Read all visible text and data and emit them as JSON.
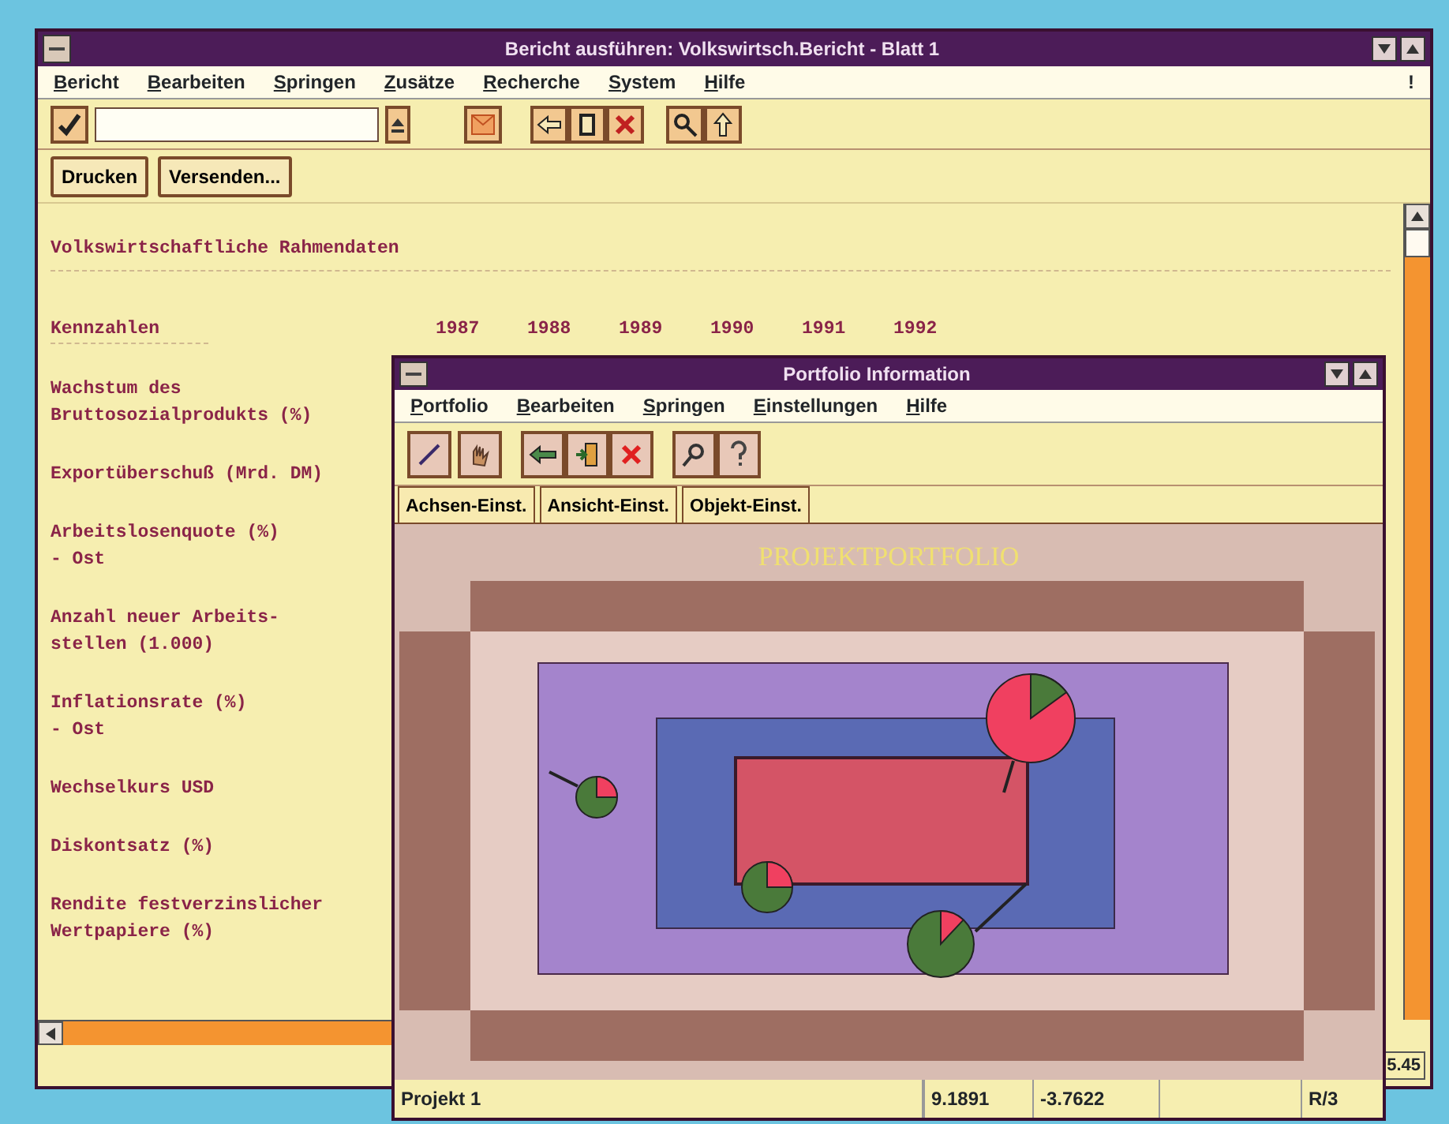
{
  "main_window": {
    "title": "Bericht ausführen: Volkswirtsch.Bericht - Blatt 1",
    "menu": [
      "Bericht",
      "Bearbeiten",
      "Springen",
      "Zusätze",
      "Recherche",
      "System",
      "Hilfe"
    ],
    "menu_extra": "!",
    "buttons": [
      "Drucken",
      "Versenden..."
    ],
    "report": {
      "heading": "Volkswirtschaftliche Rahmendaten",
      "columns_label": "Kennzahlen",
      "years": [
        "1987",
        "1988",
        "1989",
        "1990",
        "1991",
        "1992"
      ],
      "rows": [
        {
          "lines": [
            "Wachstum des",
            "Bruttosozialprodukts (%)"
          ]
        },
        {
          "lines": [
            "Exportüberschuß (Mrd. DM)"
          ]
        },
        {
          "lines": [
            "Arbeitslosenquote (%)",
            "- Ost"
          ]
        },
        {
          "lines": [
            "Anzahl neuer Arbeits-",
            "stellen (1.000)"
          ]
        },
        {
          "lines": [
            "Inflationsrate (%)",
            "- Ost"
          ]
        },
        {
          "lines": [
            "Wechselkurs USD"
          ]
        },
        {
          "lines": [
            "Diskontsatz (%)"
          ]
        },
        {
          "lines": [
            "Rendite festverzinslicher",
            "Wertpapiere (%)"
          ]
        }
      ]
    },
    "status_value": "5.45"
  },
  "portfolio_window": {
    "title": "Portfolio Information",
    "menu": [
      "Portfolio",
      "Bearbeiten",
      "Springen",
      "Einstellungen",
      "Hilfe"
    ],
    "tabs": [
      "Achsen-Einst.",
      "Ansicht-Einst.",
      "Objekt-Einst."
    ],
    "chart": {
      "title": "PROJEKTPORTFOLIO"
    },
    "status_bar": {
      "project": "Projekt 1",
      "x_value": "9.1891",
      "y_value": "-3.7622",
      "mode": "R/3"
    }
  }
}
